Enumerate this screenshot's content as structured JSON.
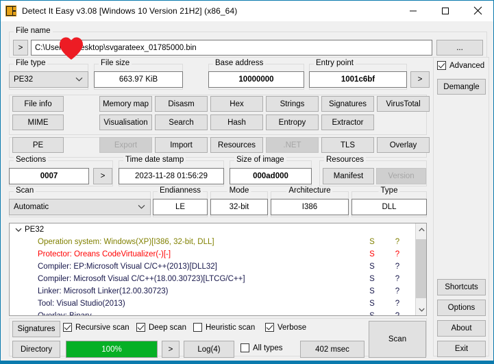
{
  "window": {
    "title": "Detect It Easy v3.08 [Windows 10 Version 21H2] (x86_64)",
    "icon": "die-app-icon",
    "minimize": "minimize-icon",
    "maximize": "maximize-icon",
    "close": "close-icon",
    "accent_color": "#0a7aad"
  },
  "file_name": {
    "caption": "File name",
    "browse_history_label": ">",
    "value": "C:\\Users\\♥\\Desktop\\svgarateex_01785000.bin",
    "value_prefix": "C:\\Users\\",
    "value_suffix": "\\Desktop\\svgarateex_01785000.bin",
    "open_label": "...",
    "sticker": "red-heart"
  },
  "file_type": {
    "caption": "File type",
    "value": "PE32"
  },
  "file_size": {
    "caption": "File size",
    "value": "663.97 KiB"
  },
  "base_address": {
    "caption": "Base address",
    "value": "10000000"
  },
  "entry_point": {
    "caption": "Entry point",
    "value": "1001c6bf",
    "goto_label": ">"
  },
  "advanced": {
    "label": "Advanced",
    "checked": true
  },
  "demangle": {
    "label": "Demangle"
  },
  "tool_buttons": {
    "row1": [
      {
        "label": "File info",
        "enabled": true
      },
      {
        "label": "Memory map",
        "enabled": true
      },
      {
        "label": "Disasm",
        "enabled": true
      },
      {
        "label": "Hex",
        "enabled": true
      },
      {
        "label": "Strings",
        "enabled": true
      },
      {
        "label": "Signatures",
        "enabled": true
      },
      {
        "label": "VirusTotal",
        "enabled": true
      }
    ],
    "row2": [
      {
        "label": "MIME",
        "enabled": true
      },
      {
        "label": "Visualisation",
        "enabled": true
      },
      {
        "label": "Search",
        "enabled": true
      },
      {
        "label": "Hash",
        "enabled": true
      },
      {
        "label": "Entropy",
        "enabled": true
      },
      {
        "label": "Extractor",
        "enabled": true
      }
    ],
    "row3": [
      {
        "label": "PE",
        "enabled": true
      },
      {
        "label": "Export",
        "enabled": false
      },
      {
        "label": "Import",
        "enabled": true
      },
      {
        "label": "Resources",
        "enabled": true
      },
      {
        "label": ".NET",
        "enabled": false
      },
      {
        "label": "TLS",
        "enabled": true
      },
      {
        "label": "Overlay",
        "enabled": true
      }
    ]
  },
  "sections": {
    "caption": "Sections",
    "value": "0007",
    "goto_label": ">"
  },
  "time_date_stamp": {
    "caption": "Time date stamp",
    "value": "2023-11-28 01:56:29"
  },
  "size_of_image": {
    "caption": "Size of image",
    "value": "000ad000"
  },
  "resources": {
    "caption": "Resources",
    "manifest_label": "Manifest",
    "manifest_enabled": true,
    "version_label": "Version",
    "version_enabled": false
  },
  "scan": {
    "caption": "Scan",
    "value": "Automatic"
  },
  "endianness": {
    "caption": "Endianness",
    "value": "LE"
  },
  "mode": {
    "caption": "Mode",
    "value": "32-bit"
  },
  "architecture": {
    "caption": "Architecture",
    "value": "I386"
  },
  "type": {
    "caption": "Type",
    "value": "DLL"
  },
  "results": {
    "root": {
      "label": "PE32",
      "expanded": true,
      "expander": "chevron-down-icon"
    },
    "rows": [
      {
        "label": "Operation system: Windows(XP)[I386, 32-bit, DLL]",
        "signature": "S",
        "info": "?",
        "color": "#808000"
      },
      {
        "label": "Protector: Oreans CodeVirtualizer(-)[-]",
        "signature": "S",
        "info": "?",
        "color": "#ff0000"
      },
      {
        "label": "Compiler: EP:Microsoft Visual C/C++(2013)[DLL32]",
        "signature": "S",
        "info": "?",
        "color": "#1a1a4e"
      },
      {
        "label": "Compiler: Microsoft Visual C/C++(18.00.30723)[LTCG/C++]",
        "signature": "S",
        "info": "?",
        "color": "#1a1a4e"
      },
      {
        "label": "Linker: Microsoft Linker(12.00.30723)",
        "signature": "S",
        "info": "?",
        "color": "#1a1a4e"
      },
      {
        "label": "Tool: Visual Studio(2013)",
        "signature": "S",
        "info": "?",
        "color": "#1a1a4e"
      },
      {
        "label": "Overlay: Binary",
        "signature": "S",
        "info": "?",
        "color": "#1a1a4e"
      }
    ],
    "scrollbar": {
      "up": "scroll-up-icon",
      "down": "scroll-down-icon"
    }
  },
  "scan_options": {
    "signatures_label": "Signatures",
    "directory_label": "Directory",
    "recursive_scan": {
      "label": "Recursive scan",
      "checked": true
    },
    "deep_scan": {
      "label": "Deep scan",
      "checked": true
    },
    "heuristic_scan": {
      "label": "Heuristic scan",
      "checked": false
    },
    "verbose": {
      "label": "Verbose",
      "checked": true
    },
    "all_types": {
      "label": "All types",
      "checked": false
    },
    "progress": {
      "value": "100%",
      "color": "#06b025"
    },
    "progress_more_label": ">",
    "log_label": "Log(4)",
    "elapsed": "402 msec",
    "scan_label": "Scan"
  },
  "side_buttons": {
    "shortcuts": "Shortcuts",
    "options": "Options",
    "about": "About",
    "exit": "Exit"
  }
}
